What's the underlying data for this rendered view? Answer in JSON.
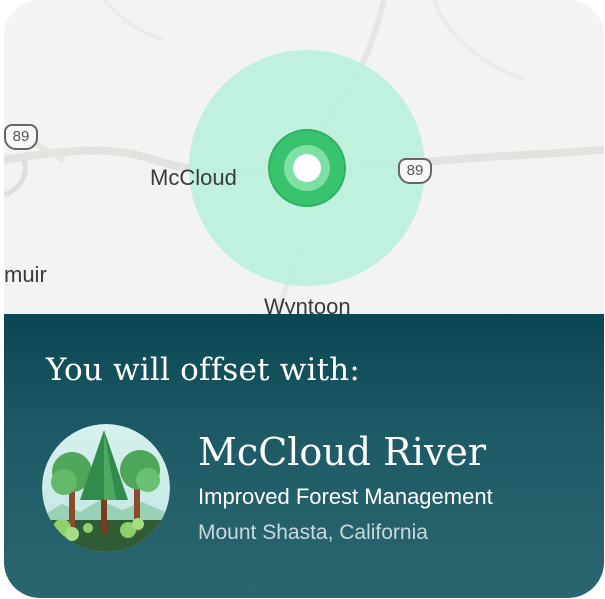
{
  "map": {
    "town_label": "McCloud",
    "town_west_label": "muir",
    "town_south_label": "Wyntoon",
    "route_shield_west": "89",
    "route_shield_east": "89",
    "radius_color": "#bdf0dc",
    "marker_color": "#39c36e",
    "marker_icon": "location-pin-ring"
  },
  "offset": {
    "headline": "You will offset with:",
    "project_name": "McCloud River",
    "project_type": "Improved Forest Management",
    "project_location": "Mount Shasta, California",
    "project_icon": "forest-illustration",
    "panel_color": "#0b4753"
  }
}
